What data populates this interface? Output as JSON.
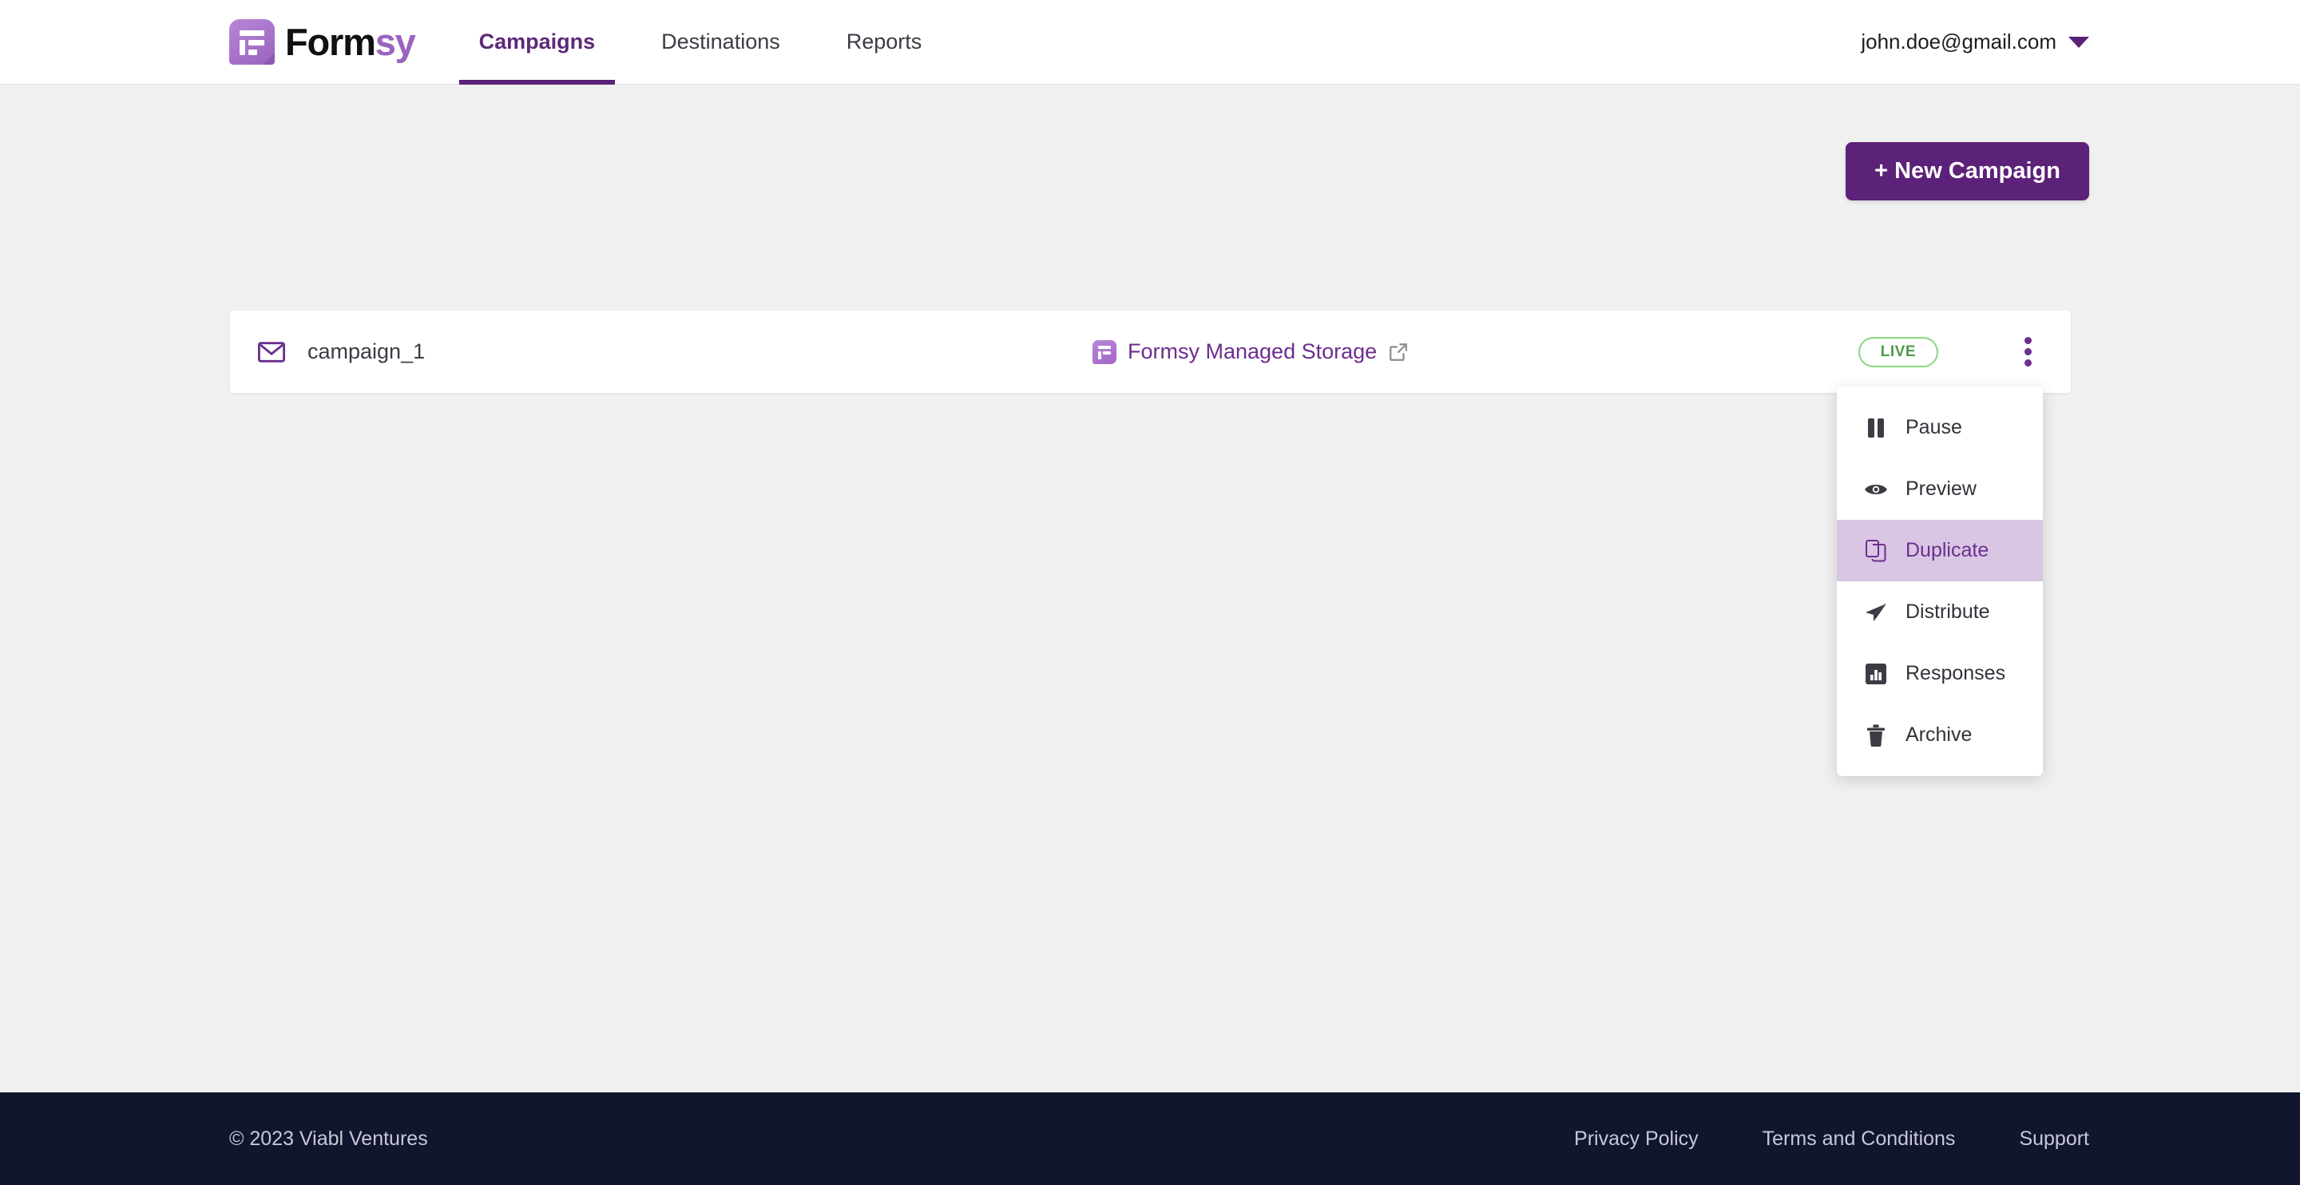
{
  "header": {
    "logo": {
      "icon": "formsy-logo-icon",
      "text_primary": "Form",
      "text_accent": "sy"
    },
    "nav": [
      {
        "label": "Campaigns",
        "active": true
      },
      {
        "label": "Destinations",
        "active": false
      },
      {
        "label": "Reports",
        "active": false
      }
    ],
    "user": {
      "email": "john.doe@gmail.com",
      "caret_icon": "chevron-down-icon"
    }
  },
  "toolbar": {
    "new_campaign_label": "+ New Campaign"
  },
  "campaign_row": {
    "type_icon": "mail-icon",
    "name": "campaign_1",
    "storage": {
      "icon": "formsy-logo-icon",
      "label": "Formsy Managed Storage",
      "external_link_icon": "external-link-icon"
    },
    "status_badge": "LIVE",
    "menu_icon": "kebab-menu-icon"
  },
  "context_menu": {
    "items": [
      {
        "label": "Pause",
        "icon": "pause-icon",
        "selected": false
      },
      {
        "label": "Preview",
        "icon": "eye-icon",
        "selected": false
      },
      {
        "label": "Duplicate",
        "icon": "copy-icon",
        "selected": true
      },
      {
        "label": "Distribute",
        "icon": "paper-plane-icon",
        "selected": false
      },
      {
        "label": "Responses",
        "icon": "bar-chart-icon",
        "selected": false
      },
      {
        "label": "Archive",
        "icon": "trash-icon",
        "selected": false
      }
    ]
  },
  "footer": {
    "copyright": "© 2023 Viabl Ventures",
    "links": [
      {
        "label": "Privacy Policy"
      },
      {
        "label": "Terms and Conditions"
      },
      {
        "label": "Support"
      }
    ]
  },
  "colors": {
    "brand_purple": "#5c2178",
    "accent_purple": "#9a63c0",
    "menu_highlight": "#d9c6e4",
    "status_green": "#4f9a4a",
    "footer_navy": "#11152e",
    "page_background": "#f0f0f0"
  }
}
